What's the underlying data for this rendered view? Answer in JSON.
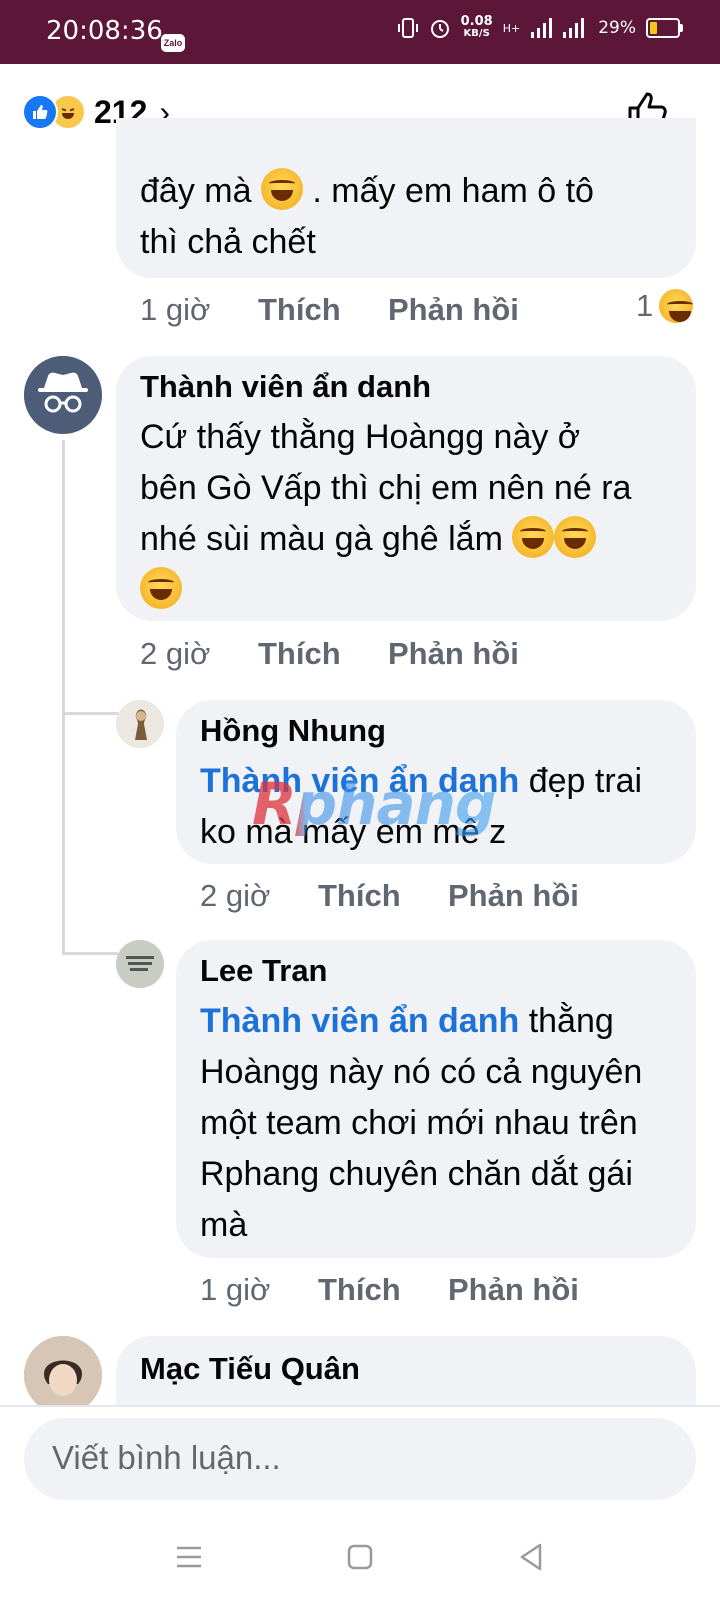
{
  "status_bar": {
    "time": "20:08:36",
    "zalo_label": "Zalo",
    "speed_value": "0.08",
    "speed_unit": "KB/S",
    "network": "H+",
    "battery": "29%"
  },
  "reactions": {
    "count": "212",
    "chevron": "›",
    "icons": [
      "like-icon",
      "haha-icon"
    ]
  },
  "comments": [
    {
      "text_line1": "đây mà",
      "text_line1b": ". mấy em ham ô tô",
      "text_line2": "thì chả chết",
      "time": "1 giờ",
      "like": "Thích",
      "reply": "Phản hồi",
      "reaction_count": "1"
    },
    {
      "author": "Thành viên ẩn danh",
      "text_line1": "Cứ thấy thằng Hoàngg này ở",
      "text_line2": "bên Gò Vấp thì chị em nên né ra",
      "text_line3": "nhé sùi màu gà ghê lắm",
      "time": "2 giờ",
      "like": "Thích",
      "reply": "Phản hồi"
    },
    {
      "author": "Hồng Nhung",
      "mention": "Thành viên ẩn danh",
      "text_line1": " đẹp trai",
      "text_line2": "ko mà mấy em mê z",
      "time": "2 giờ",
      "like": "Thích",
      "reply": "Phản hồi"
    },
    {
      "author": "Lee Tran",
      "mention": "Thành viên ẩn danh",
      "text_line1": " thằng",
      "text_line2": "Hoàngg này nó có cả nguyên",
      "text_line3": "một team chơi mới nhau trên",
      "text_line4": "Rphang chuyên chăn dắt gái",
      "text_line5": "mà",
      "time": "1 giờ",
      "like": "Thích",
      "reply": "Phản hồi"
    },
    {
      "author": "Mạc Tiếu Quân"
    }
  ],
  "watermark": "Rphang",
  "comment_input": {
    "placeholder": "Viết bình luận..."
  },
  "colors": {
    "status_bar": "#5c1638",
    "like_blue": "#1877f2",
    "mention": "#1d72d8",
    "bubble": "#f0f2f5"
  }
}
